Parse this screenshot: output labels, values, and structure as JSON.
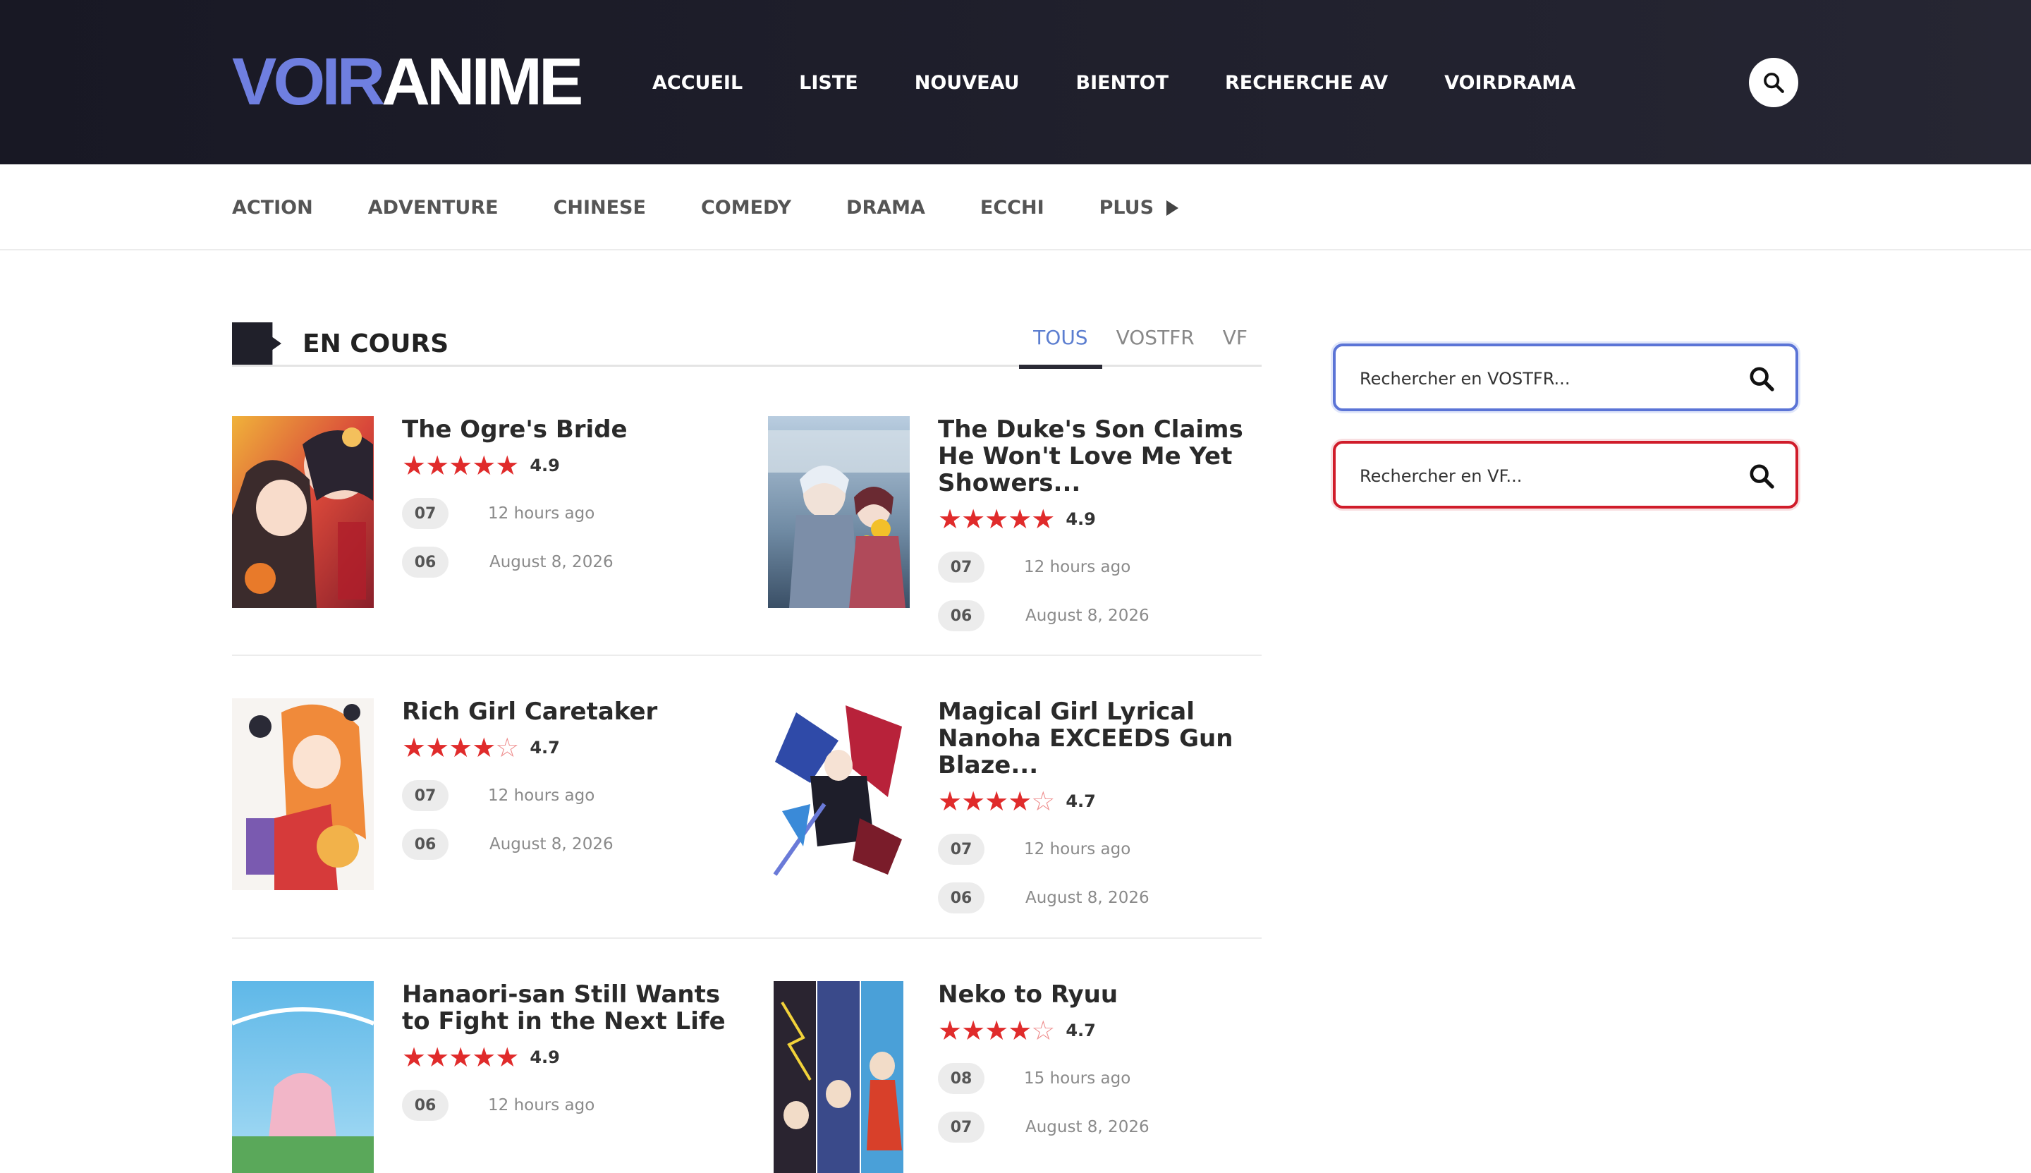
{
  "brand": {
    "logo_part1": "VOIR",
    "logo_part2": "ANIME"
  },
  "nav": [
    "ACCUEIL",
    "LISTE",
    "NOUVEAU",
    "BIENTOT",
    "RECHERCHE AV",
    "VOIRDRAMA"
  ],
  "genres": [
    "ACTION",
    "ADVENTURE",
    "CHINESE",
    "COMEDY",
    "DRAMA",
    "ECCHI"
  ],
  "genres_more": "PLUS",
  "section": {
    "title": "EN COURS",
    "tabs": [
      "TOUS",
      "VOSTFR",
      "VF"
    ],
    "active_tab": "TOUS"
  },
  "cards": [
    {
      "title": "The Ogre's Bride",
      "rating": "4.9",
      "stars": 5,
      "episodes": [
        {
          "ep": "07",
          "time": "12 hours ago"
        },
        {
          "ep": "06",
          "time": "August 8, 2026"
        }
      ]
    },
    {
      "title": "The Duke's Son Claims He Won't Love Me Yet Showers...",
      "rating": "4.9",
      "stars": 5,
      "episodes": [
        {
          "ep": "07",
          "time": "12 hours ago"
        },
        {
          "ep": "06",
          "time": "August 8, 2026"
        }
      ]
    },
    {
      "title": "Rich Girl Caretaker",
      "rating": "4.7",
      "stars": 4.5,
      "episodes": [
        {
          "ep": "07",
          "time": "12 hours ago"
        },
        {
          "ep": "06",
          "time": "August 8, 2026"
        }
      ]
    },
    {
      "title": "Magical Girl Lyrical Nanoha EXCEEDS Gun Blaze...",
      "rating": "4.7",
      "stars": 4.5,
      "episodes": [
        {
          "ep": "07",
          "time": "12 hours ago"
        },
        {
          "ep": "06",
          "time": "August 8, 2026"
        }
      ]
    },
    {
      "title": "Hanaori-san Still Wants to Fight in the Next Life",
      "rating": "4.9",
      "stars": 5,
      "episodes": [
        {
          "ep": "06",
          "time": "12 hours ago"
        }
      ]
    },
    {
      "title": "Neko to Ryuu",
      "rating": "4.7",
      "stars": 4.5,
      "episodes": [
        {
          "ep": "08",
          "time": "15 hours ago"
        },
        {
          "ep": "07",
          "time": "August 8, 2026"
        }
      ]
    }
  ],
  "sidebar": {
    "search_vostfr_placeholder": "Rechercher en VOSTFR...",
    "search_vf_placeholder": "Rechercher en VF..."
  },
  "colors": {
    "header_bg": "#1d1d29",
    "logo_accent": "#6f7fe0",
    "star": "#e02b2b",
    "tab_active": "#5c7ed0",
    "vostfr_border": "#5b74d6",
    "vf_border": "#d01c2a"
  },
  "icons": {
    "header_search": "search-icon",
    "genres_more": "triangle-right-icon",
    "sidebar_search": "search-icon"
  }
}
